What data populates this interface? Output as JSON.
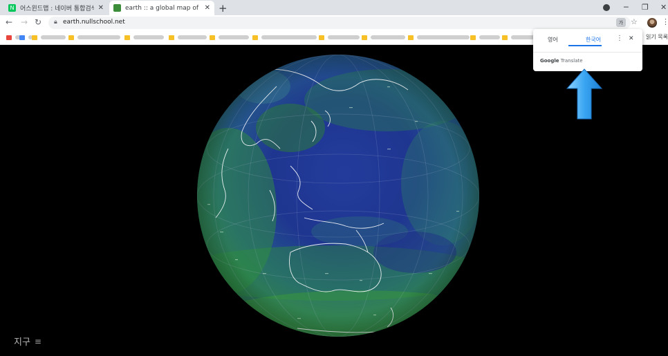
{
  "tabs": [
    {
      "title": "어스윈드맵 : 네이버 통합검색",
      "favicon_color": "#03c75a",
      "favicon_text": "N"
    },
    {
      "title": "earth :: a global map of wind, w",
      "favicon_color": "#3c8d3a",
      "favicon_text": ""
    }
  ],
  "window": {
    "minimize": "─",
    "restore": "❐",
    "close": "✕"
  },
  "address": {
    "url": "earth.nullschool.net",
    "translate_badge": "가"
  },
  "reading_list": "읽기 목록",
  "translate_popup": {
    "source_lang": "영어",
    "target_lang": "한국어",
    "brand_bold": "Google",
    "brand_rest": " Translate",
    "more": "⋮",
    "close": "✕"
  },
  "page": {
    "earth_label": "지구",
    "menu_glyph": "≡"
  },
  "colors": {
    "accent": "#1a73e8",
    "arrow": "#4fb3f7",
    "ocean_low": "#1c2f8a",
    "wind_high": "#2e8a3c"
  },
  "icons": [
    "back-icon",
    "forward-icon",
    "reload-icon",
    "lock-icon",
    "translate-icon",
    "star-icon",
    "avatar",
    "menu-icon",
    "arrow-up-icon"
  ]
}
